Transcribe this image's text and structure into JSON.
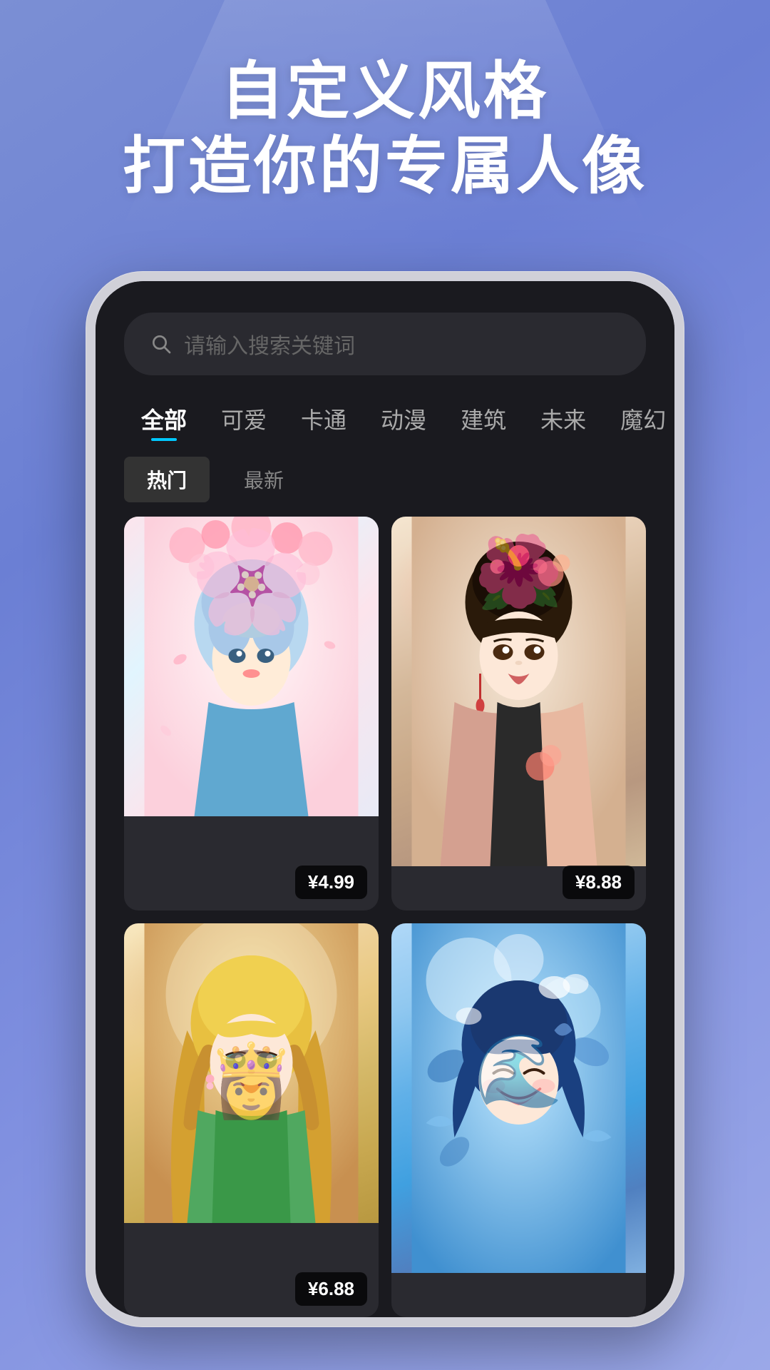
{
  "hero": {
    "title_line1": "自定义风格",
    "title_line2": "打造你的专属人像"
  },
  "search": {
    "placeholder": "请输入搜索关键词"
  },
  "categories": [
    {
      "id": "all",
      "label": "全部",
      "active": true
    },
    {
      "id": "cute",
      "label": "可爱",
      "active": false
    },
    {
      "id": "cartoon",
      "label": "卡通",
      "active": false
    },
    {
      "id": "anime",
      "label": "动漫",
      "active": false
    },
    {
      "id": "arch",
      "label": "建筑",
      "active": false
    },
    {
      "id": "future",
      "label": "未来",
      "active": false
    },
    {
      "id": "magic",
      "label": "魔幻",
      "active": false
    }
  ],
  "sort_tabs": [
    {
      "id": "hot",
      "label": "热门",
      "active": true
    },
    {
      "id": "new",
      "label": "最新",
      "active": false
    }
  ],
  "grid": {
    "cards": [
      {
        "id": "card1",
        "price": "¥4.99",
        "col": 1,
        "row": 1
      },
      {
        "id": "card2",
        "price": "¥8.88",
        "col": 2,
        "row": 1
      },
      {
        "id": "card3",
        "price": "¥6.88",
        "col": 1,
        "row": 2
      },
      {
        "id": "card4",
        "price": null,
        "col": 2,
        "row": 2
      }
    ]
  },
  "colors": {
    "accent_blue": "#00c8ff",
    "bg_dark": "#1a1a1f",
    "card_bg": "#2a2a30"
  }
}
